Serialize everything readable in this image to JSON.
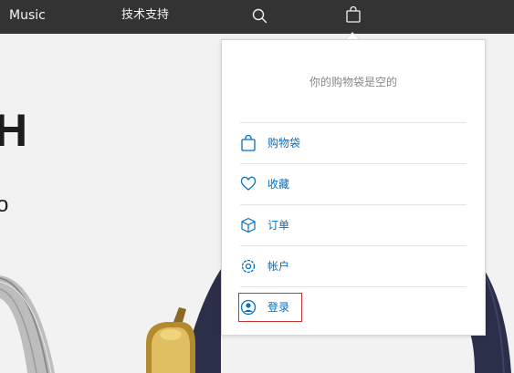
{
  "nav": {
    "music_label": "Music",
    "support_label": "技术支持",
    "search_icon": "search-icon",
    "bag_icon": "bag-icon"
  },
  "hero": {
    "title": "H",
    "subtitle": "o"
  },
  "bag_menu": {
    "empty_message": "你的购物袋是空的",
    "items": [
      {
        "label": "购物袋",
        "icon": "bag-icon"
      },
      {
        "label": "收藏",
        "icon": "heart-icon"
      },
      {
        "label": "订单",
        "icon": "box-icon"
      },
      {
        "label": "帐户",
        "icon": "gear-icon"
      },
      {
        "label": "登录",
        "icon": "user-icon"
      }
    ]
  },
  "colors": {
    "nav_bg": "#333333",
    "link": "#0070c9",
    "highlight": "#cc3333"
  }
}
